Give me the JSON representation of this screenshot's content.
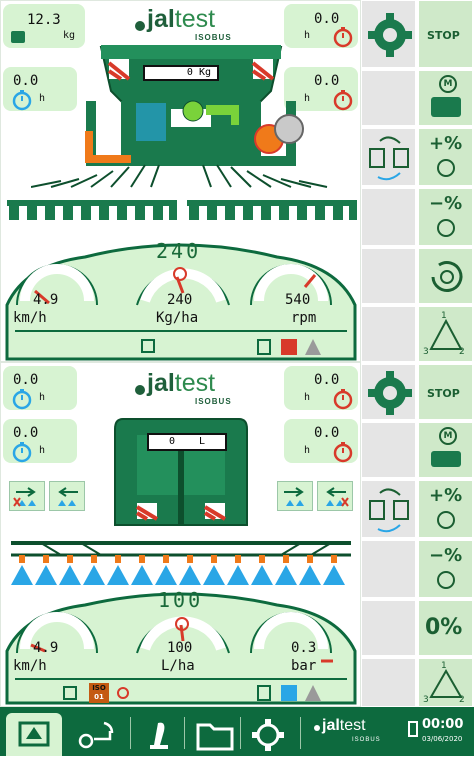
{
  "top": {
    "logo": {
      "prefix": "jal",
      "suffix": "test",
      "sub": "ISOBUS"
    },
    "weight": {
      "value": "12.3",
      "unit": "kg"
    },
    "timer_tl": {
      "value": "0.0",
      "unit": "h"
    },
    "timer_tr1": {
      "value": "0.0",
      "unit": "h"
    },
    "timer_tr2": {
      "value": "0.0",
      "unit": "h"
    },
    "tank_display": "0 Kg",
    "target_rate": "240",
    "gauges": [
      {
        "value": "4.9",
        "unit": "km/h"
      },
      {
        "value": "240",
        "unit": "Kg/ha"
      },
      {
        "value": "540",
        "unit": "rpm"
      }
    ]
  },
  "bottom": {
    "logo": {
      "prefix": "jal",
      "suffix": "test",
      "sub": "ISOBUS"
    },
    "timer_tl1": {
      "value": "0.0",
      "unit": "h"
    },
    "timer_tl2": {
      "value": "0.0",
      "unit": "h"
    },
    "timer_tr1": {
      "value": "0.0",
      "unit": "h"
    },
    "timer_tr2": {
      "value": "0.0",
      "unit": "h"
    },
    "tank_display": "0    L",
    "target_rate": "100",
    "gauges": [
      {
        "value": "4.9",
        "unit": "km/h"
      },
      {
        "value": "100",
        "unit": "L/ha"
      },
      {
        "value": "0.3",
        "unit": "bar"
      }
    ],
    "iso_badge": {
      "line1": "ISO",
      "line2": "01"
    }
  },
  "sidebar": {
    "stop_top": "STOP",
    "stop_bottom": "STOP",
    "plus_pct": "+%",
    "minus_pct": "−%",
    "plus_pct_b": "+%",
    "minus_pct_b": "−%",
    "zero_pct": "0%",
    "manual_badge": "M",
    "route": [
      "1",
      "2",
      "3"
    ]
  },
  "bottom_bar": {
    "logo_prefix": "jal",
    "logo_suffix": "test",
    "logo_sub": "ISOBUS",
    "clock": "00:00",
    "date": "03/06/2020"
  },
  "colors": {
    "brand_green": "#0d6a3e",
    "panel_green": "#d7f3d2",
    "machine_green": "#1a7a4d",
    "accent_red": "#d83a2a",
    "accent_orange": "#f07a1a",
    "nozzle_blue": "#2aa6e6"
  }
}
